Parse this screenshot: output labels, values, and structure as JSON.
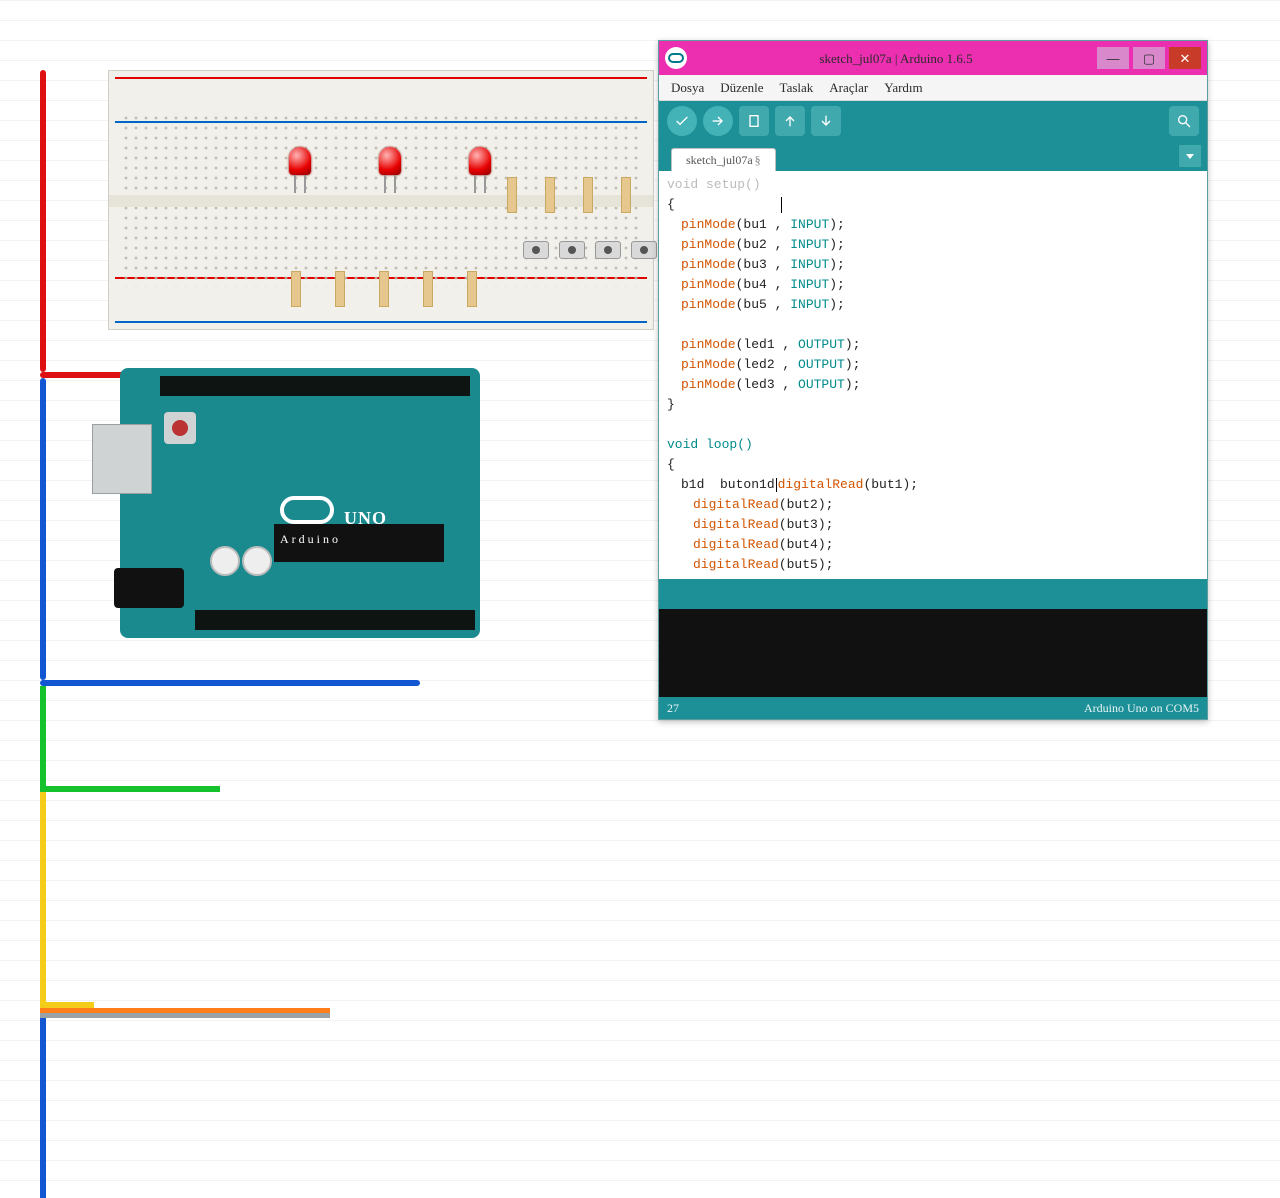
{
  "window": {
    "title": "sketch_jul07a | Arduino 1.6.5"
  },
  "menus": {
    "file": "Dosya",
    "edit": "Düzenle",
    "sketch": "Taslak",
    "tools": "Araçlar",
    "help": "Yardım"
  },
  "tab": {
    "name": "sketch_jul07a",
    "modified_marker": "§"
  },
  "code": {
    "setup_signature": "void setup()",
    "open_brace": "{",
    "close_brace": "}",
    "pinmode": "pinMode",
    "digitalread": "digitalRead",
    "input": "INPUT",
    "output": "OUTPUT",
    "bu1": "(bu1 , ",
    "bu2": "(bu2 , ",
    "bu3": "(bu3 , ",
    "bu4": "(bu4 , ",
    "bu5": "(bu5 , ",
    "led1": "(led1 , ",
    "led2": "(led2 , ",
    "led3": "(led3 , ",
    "endln": ");",
    "loop_signature": "void loop()",
    "b1d_line_pre": "b1d  buton1d",
    "b1d_line_post": "(but1);",
    "dr_but2": "(but2);",
    "dr_but3": "(but3);",
    "dr_but4": "(but4);",
    "dr_but5": "(but5);"
  },
  "footer": {
    "line": "27",
    "board": "Arduino Uno on COM5"
  },
  "arduino_label": "Arduino",
  "uno_label": "UNO"
}
